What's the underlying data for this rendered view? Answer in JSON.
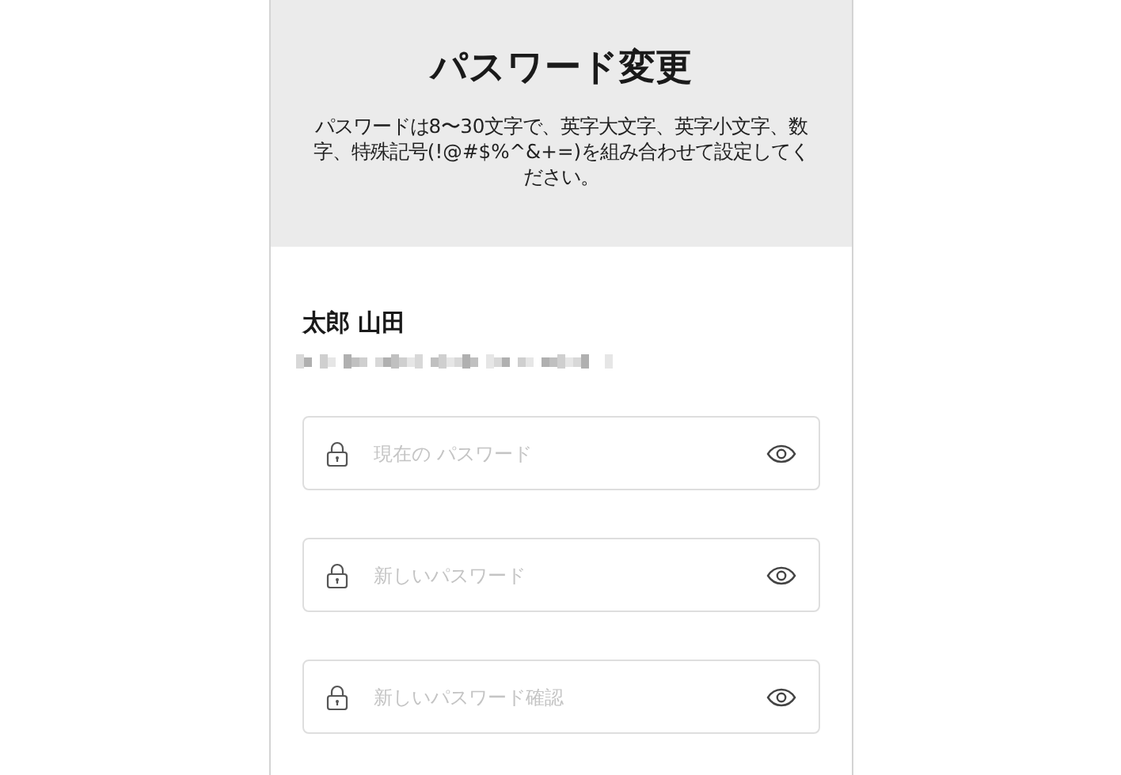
{
  "header": {
    "title": "パスワード変更",
    "description": "パスワードは8〜30文字で、英字大文字、英字小文字、数字、特殊記号(!@#$%^&+=)を組み合わせて設定してください。"
  },
  "user": {
    "name": "太郎 山田"
  },
  "fields": [
    {
      "placeholder": "現在の パスワード"
    },
    {
      "placeholder": "新しいパスワード"
    },
    {
      "placeholder": "新しいパスワード確認"
    }
  ]
}
